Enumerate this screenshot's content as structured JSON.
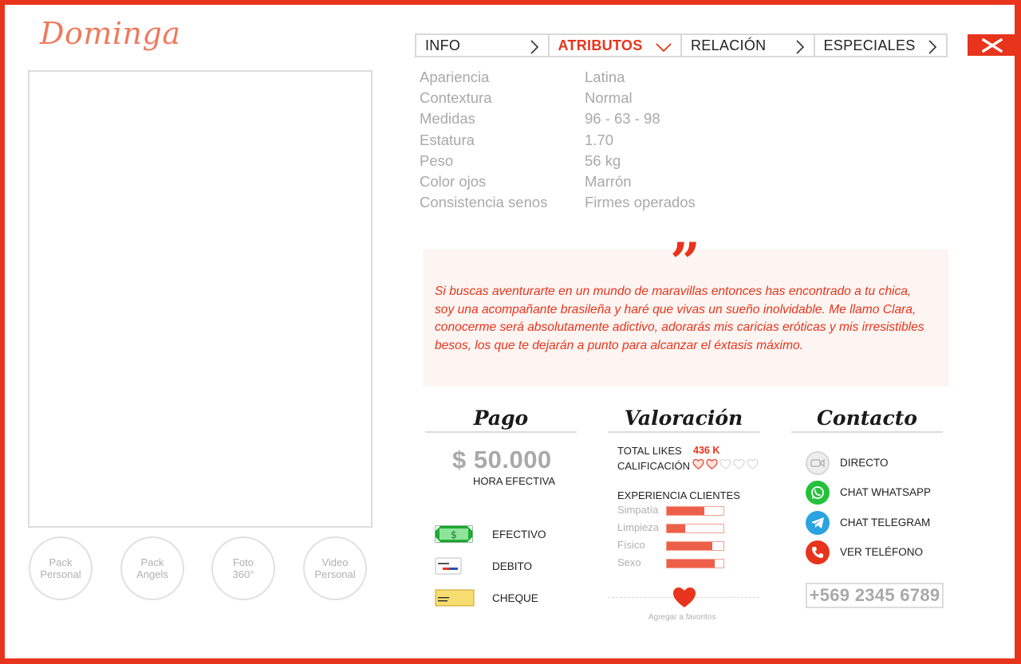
{
  "brand": {
    "logo": "Dominga"
  },
  "packs": [
    {
      "line1": "Pack",
      "line2": "Personal"
    },
    {
      "line1": "Pack",
      "line2": "Angels"
    },
    {
      "line1": "Foto",
      "line2": "360°"
    },
    {
      "line1": "Video",
      "line2": "Personal"
    }
  ],
  "tabs": [
    {
      "label": "INFO",
      "active": false
    },
    {
      "label": "ATRIBUTOS",
      "active": true
    },
    {
      "label": "RELACIÓN",
      "active": false
    },
    {
      "label": "ESPECIALES",
      "active": false
    }
  ],
  "attributes": [
    {
      "key": "Apariencia",
      "value": "Latina"
    },
    {
      "key": "Contextura",
      "value": "Normal"
    },
    {
      "key": "Medidas",
      "value": "96 - 63 - 98"
    },
    {
      "key": "Estatura",
      "value": "1.70"
    },
    {
      "key": "Peso",
      "value": "56 kg"
    },
    {
      "key": "Color ojos",
      "value": "Marrón"
    },
    {
      "key": "Consistencia senos",
      "value": "Firmes operados"
    }
  ],
  "quote": {
    "mark": "”",
    "text": "Si buscas aventurarte en un mundo de maravillas entonces has encontrado a tu chica, soy una acompañante brasileña y haré que vivas un sueño inolvidable. Me llamo Clara, conocerme será absolutamente adictivo, adorarás mis caricias eróticas y mis irresistibles besos, los que te dejarán a punto para alcanzar el éxtasis máximo."
  },
  "pago": {
    "title": "Pago",
    "price": "$ 50.000",
    "price_sub": "HORA EFECTIVA",
    "methods": [
      {
        "label": "EFECTIVO",
        "icon": "cash-icon"
      },
      {
        "label": "DEBITO",
        "icon": "debit-card-icon"
      },
      {
        "label": "CHEQUE",
        "icon": "cheque-icon"
      }
    ]
  },
  "valoracion": {
    "title": "Valoración",
    "likes_label": "TOTAL LIKES",
    "likes_value": "436 K",
    "rating_label": "CALIFICACIÓN",
    "rating": 2,
    "rating_max": 5,
    "experience_label": "EXPERIENCIA CLIENTES",
    "experience": [
      {
        "label": "Simpatía",
        "level": 0.66
      },
      {
        "label": "Limpieza",
        "level": 0.32
      },
      {
        "label": "Físico",
        "level": 0.8
      },
      {
        "label": "Sexo",
        "level": 0.85
      }
    ],
    "favorites_label": "Agregar a favoritos"
  },
  "contacto": {
    "title": "Contacto",
    "items": [
      {
        "label": "DIRECTO",
        "icon": "video-camera-icon",
        "color": "#e6e6e6"
      },
      {
        "label": "CHAT WHATSAPP",
        "icon": "whatsapp-icon",
        "color": "#25c13c"
      },
      {
        "label": "CHAT TELEGRAM",
        "icon": "telegram-icon",
        "color": "#2aa3e0"
      },
      {
        "label": "VER TELÉFONO",
        "icon": "phone-icon",
        "color": "#e8341c"
      }
    ],
    "phone": "+569 2345 6789"
  },
  "colors": {
    "accent": "#e8341c",
    "muted": "#a9a9a9"
  }
}
